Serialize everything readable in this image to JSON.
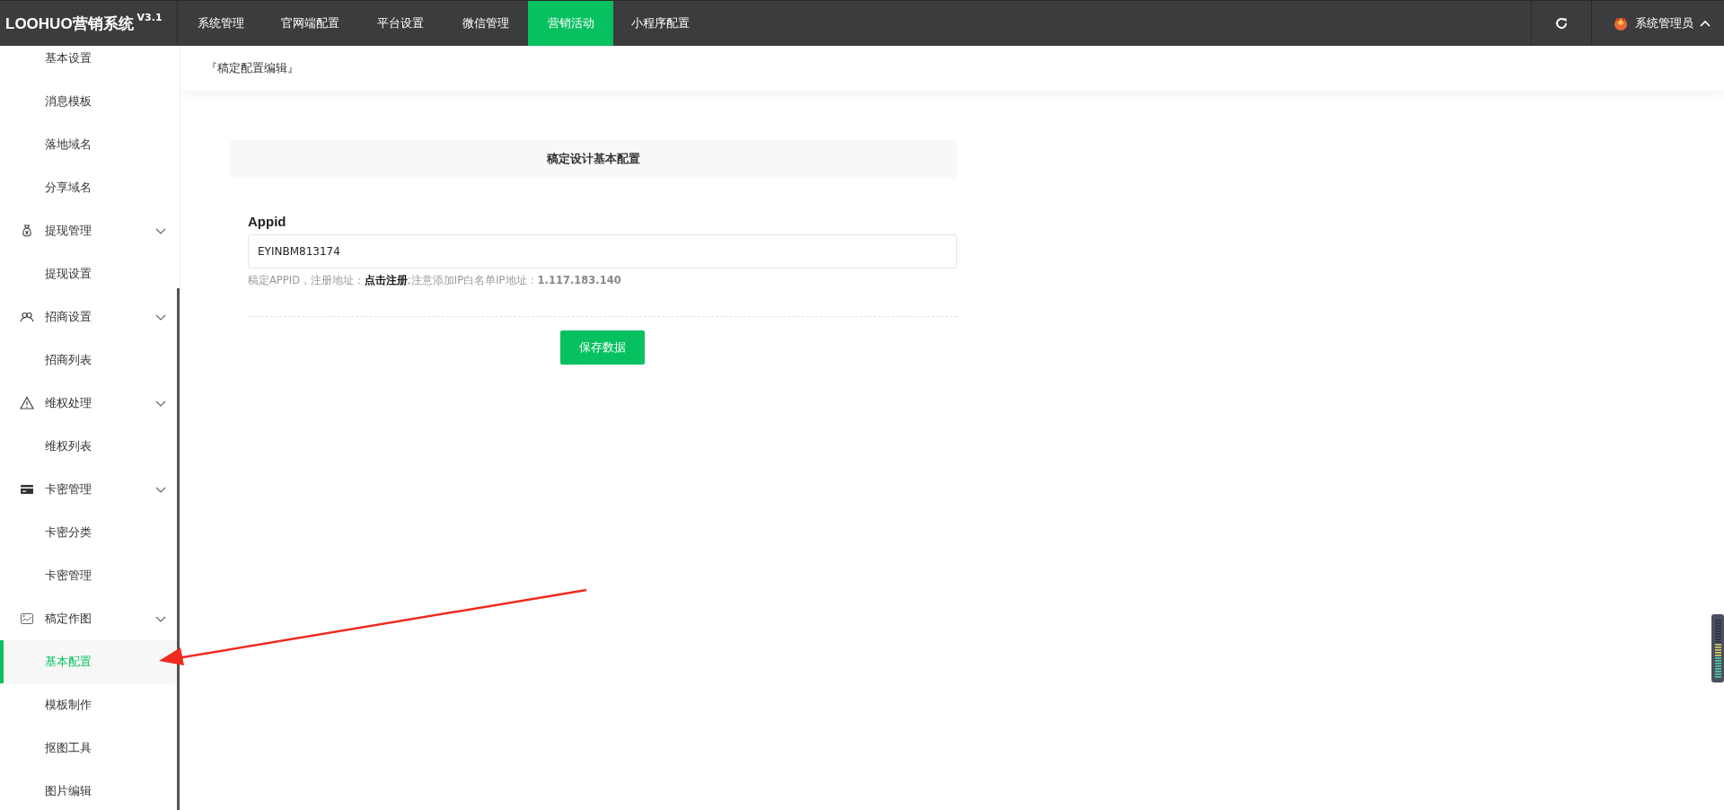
{
  "header": {
    "logo": "LOOHUO营销系统",
    "version": "V3.1",
    "nav": [
      {
        "label": "系统管理",
        "selected": false
      },
      {
        "label": "官网端配置",
        "selected": false
      },
      {
        "label": "平台设置",
        "selected": false
      },
      {
        "label": "微信管理",
        "selected": false
      },
      {
        "label": "营销活动",
        "selected": true
      },
      {
        "label": "小程序配置",
        "selected": false
      }
    ],
    "user": {
      "name": "系统管理员",
      "expanded": true
    }
  },
  "sidebar": {
    "items": [
      {
        "kind": "link",
        "label": "基本设置",
        "selected": false
      },
      {
        "kind": "link",
        "label": "消息模板",
        "selected": false
      },
      {
        "kind": "link",
        "label": "落地域名",
        "selected": false
      },
      {
        "kind": "link",
        "label": "分享域名",
        "selected": false
      },
      {
        "kind": "group",
        "label": "提现管理",
        "expanded": true,
        "children": [
          {
            "label": "提现设置",
            "selected": false
          }
        ]
      },
      {
        "kind": "group",
        "label": "招商设置",
        "expanded": true,
        "children": [
          {
            "label": "招商列表",
            "selected": false
          }
        ]
      },
      {
        "kind": "group",
        "label": "维权处理",
        "expanded": true,
        "children": [
          {
            "label": "维权列表",
            "selected": false
          }
        ]
      },
      {
        "kind": "group",
        "label": "卡密管理",
        "expanded": true,
        "children": [
          {
            "label": "卡密分类",
            "selected": false
          },
          {
            "label": "卡密管理",
            "selected": false
          }
        ]
      },
      {
        "kind": "group",
        "label": "稿定作图",
        "expanded": true,
        "children": [
          {
            "label": "基本配置",
            "selected": true
          },
          {
            "label": "模板制作",
            "selected": false
          },
          {
            "label": "抠图工具",
            "selected": false
          },
          {
            "label": "图片编辑",
            "selected": false
          }
        ]
      }
    ]
  },
  "breadcrumb": "『稿定配置编辑』",
  "form": {
    "section_title": "稿定设计基本配置",
    "field_label": "Appid",
    "field_value": "EYINBM813174",
    "hint": {
      "prefix": "稿定APPID，注册地址：",
      "link": "点击注册",
      "suffix": ";注意添加IP白名单IP地址：**1.117.183.140**"
    },
    "save_button": "保存数据"
  }
}
